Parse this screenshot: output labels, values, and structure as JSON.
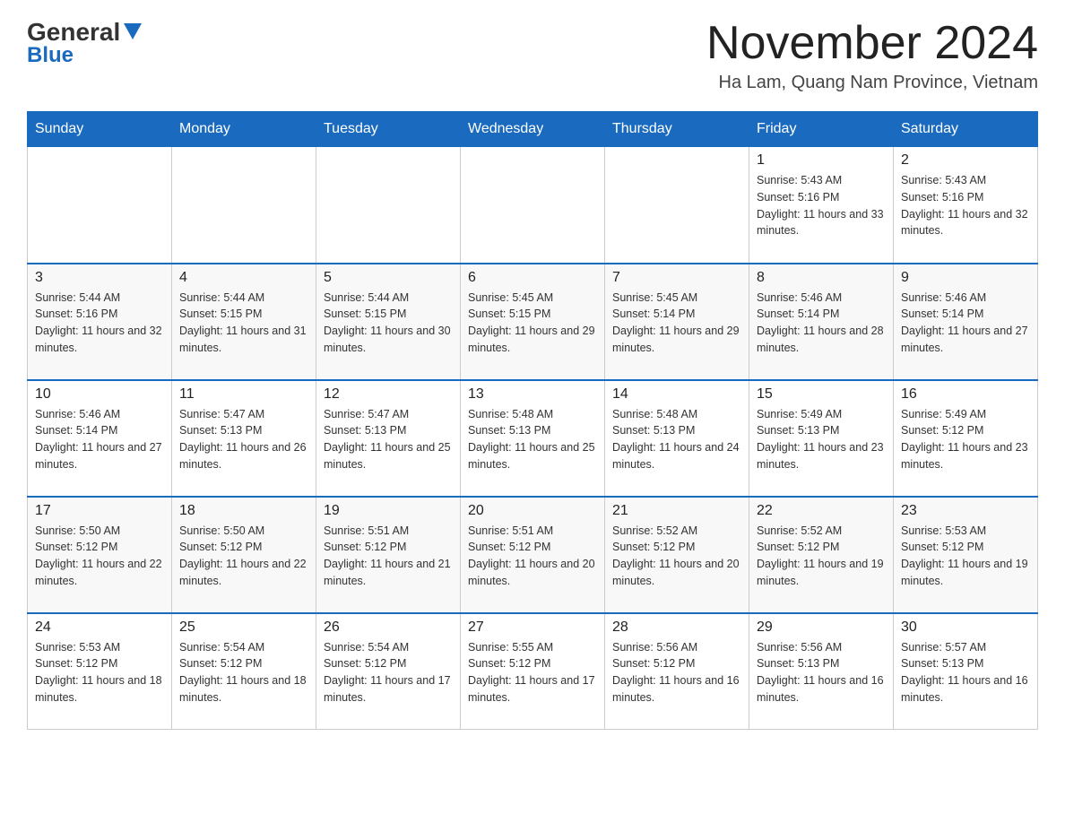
{
  "header": {
    "logo_text": "General",
    "logo_blue": "Blue",
    "month_title": "November 2024",
    "location": "Ha Lam, Quang Nam Province, Vietnam"
  },
  "days_of_week": [
    "Sunday",
    "Monday",
    "Tuesday",
    "Wednesday",
    "Thursday",
    "Friday",
    "Saturday"
  ],
  "weeks": [
    [
      {
        "day": "",
        "sunrise": "",
        "sunset": "",
        "daylight": ""
      },
      {
        "day": "",
        "sunrise": "",
        "sunset": "",
        "daylight": ""
      },
      {
        "day": "",
        "sunrise": "",
        "sunset": "",
        "daylight": ""
      },
      {
        "day": "",
        "sunrise": "",
        "sunset": "",
        "daylight": ""
      },
      {
        "day": "",
        "sunrise": "",
        "sunset": "",
        "daylight": ""
      },
      {
        "day": "1",
        "sunrise": "Sunrise: 5:43 AM",
        "sunset": "Sunset: 5:16 PM",
        "daylight": "Daylight: 11 hours and 33 minutes."
      },
      {
        "day": "2",
        "sunrise": "Sunrise: 5:43 AM",
        "sunset": "Sunset: 5:16 PM",
        "daylight": "Daylight: 11 hours and 32 minutes."
      }
    ],
    [
      {
        "day": "3",
        "sunrise": "Sunrise: 5:44 AM",
        "sunset": "Sunset: 5:16 PM",
        "daylight": "Daylight: 11 hours and 32 minutes."
      },
      {
        "day": "4",
        "sunrise": "Sunrise: 5:44 AM",
        "sunset": "Sunset: 5:15 PM",
        "daylight": "Daylight: 11 hours and 31 minutes."
      },
      {
        "day": "5",
        "sunrise": "Sunrise: 5:44 AM",
        "sunset": "Sunset: 5:15 PM",
        "daylight": "Daylight: 11 hours and 30 minutes."
      },
      {
        "day": "6",
        "sunrise": "Sunrise: 5:45 AM",
        "sunset": "Sunset: 5:15 PM",
        "daylight": "Daylight: 11 hours and 29 minutes."
      },
      {
        "day": "7",
        "sunrise": "Sunrise: 5:45 AM",
        "sunset": "Sunset: 5:14 PM",
        "daylight": "Daylight: 11 hours and 29 minutes."
      },
      {
        "day": "8",
        "sunrise": "Sunrise: 5:46 AM",
        "sunset": "Sunset: 5:14 PM",
        "daylight": "Daylight: 11 hours and 28 minutes."
      },
      {
        "day": "9",
        "sunrise": "Sunrise: 5:46 AM",
        "sunset": "Sunset: 5:14 PM",
        "daylight": "Daylight: 11 hours and 27 minutes."
      }
    ],
    [
      {
        "day": "10",
        "sunrise": "Sunrise: 5:46 AM",
        "sunset": "Sunset: 5:14 PM",
        "daylight": "Daylight: 11 hours and 27 minutes."
      },
      {
        "day": "11",
        "sunrise": "Sunrise: 5:47 AM",
        "sunset": "Sunset: 5:13 PM",
        "daylight": "Daylight: 11 hours and 26 minutes."
      },
      {
        "day": "12",
        "sunrise": "Sunrise: 5:47 AM",
        "sunset": "Sunset: 5:13 PM",
        "daylight": "Daylight: 11 hours and 25 minutes."
      },
      {
        "day": "13",
        "sunrise": "Sunrise: 5:48 AM",
        "sunset": "Sunset: 5:13 PM",
        "daylight": "Daylight: 11 hours and 25 minutes."
      },
      {
        "day": "14",
        "sunrise": "Sunrise: 5:48 AM",
        "sunset": "Sunset: 5:13 PM",
        "daylight": "Daylight: 11 hours and 24 minutes."
      },
      {
        "day": "15",
        "sunrise": "Sunrise: 5:49 AM",
        "sunset": "Sunset: 5:13 PM",
        "daylight": "Daylight: 11 hours and 23 minutes."
      },
      {
        "day": "16",
        "sunrise": "Sunrise: 5:49 AM",
        "sunset": "Sunset: 5:12 PM",
        "daylight": "Daylight: 11 hours and 23 minutes."
      }
    ],
    [
      {
        "day": "17",
        "sunrise": "Sunrise: 5:50 AM",
        "sunset": "Sunset: 5:12 PM",
        "daylight": "Daylight: 11 hours and 22 minutes."
      },
      {
        "day": "18",
        "sunrise": "Sunrise: 5:50 AM",
        "sunset": "Sunset: 5:12 PM",
        "daylight": "Daylight: 11 hours and 22 minutes."
      },
      {
        "day": "19",
        "sunrise": "Sunrise: 5:51 AM",
        "sunset": "Sunset: 5:12 PM",
        "daylight": "Daylight: 11 hours and 21 minutes."
      },
      {
        "day": "20",
        "sunrise": "Sunrise: 5:51 AM",
        "sunset": "Sunset: 5:12 PM",
        "daylight": "Daylight: 11 hours and 20 minutes."
      },
      {
        "day": "21",
        "sunrise": "Sunrise: 5:52 AM",
        "sunset": "Sunset: 5:12 PM",
        "daylight": "Daylight: 11 hours and 20 minutes."
      },
      {
        "day": "22",
        "sunrise": "Sunrise: 5:52 AM",
        "sunset": "Sunset: 5:12 PM",
        "daylight": "Daylight: 11 hours and 19 minutes."
      },
      {
        "day": "23",
        "sunrise": "Sunrise: 5:53 AM",
        "sunset": "Sunset: 5:12 PM",
        "daylight": "Daylight: 11 hours and 19 minutes."
      }
    ],
    [
      {
        "day": "24",
        "sunrise": "Sunrise: 5:53 AM",
        "sunset": "Sunset: 5:12 PM",
        "daylight": "Daylight: 11 hours and 18 minutes."
      },
      {
        "day": "25",
        "sunrise": "Sunrise: 5:54 AM",
        "sunset": "Sunset: 5:12 PM",
        "daylight": "Daylight: 11 hours and 18 minutes."
      },
      {
        "day": "26",
        "sunrise": "Sunrise: 5:54 AM",
        "sunset": "Sunset: 5:12 PM",
        "daylight": "Daylight: 11 hours and 17 minutes."
      },
      {
        "day": "27",
        "sunrise": "Sunrise: 5:55 AM",
        "sunset": "Sunset: 5:12 PM",
        "daylight": "Daylight: 11 hours and 17 minutes."
      },
      {
        "day": "28",
        "sunrise": "Sunrise: 5:56 AM",
        "sunset": "Sunset: 5:12 PM",
        "daylight": "Daylight: 11 hours and 16 minutes."
      },
      {
        "day": "29",
        "sunrise": "Sunrise: 5:56 AM",
        "sunset": "Sunset: 5:13 PM",
        "daylight": "Daylight: 11 hours and 16 minutes."
      },
      {
        "day": "30",
        "sunrise": "Sunrise: 5:57 AM",
        "sunset": "Sunset: 5:13 PM",
        "daylight": "Daylight: 11 hours and 16 minutes."
      }
    ]
  ]
}
